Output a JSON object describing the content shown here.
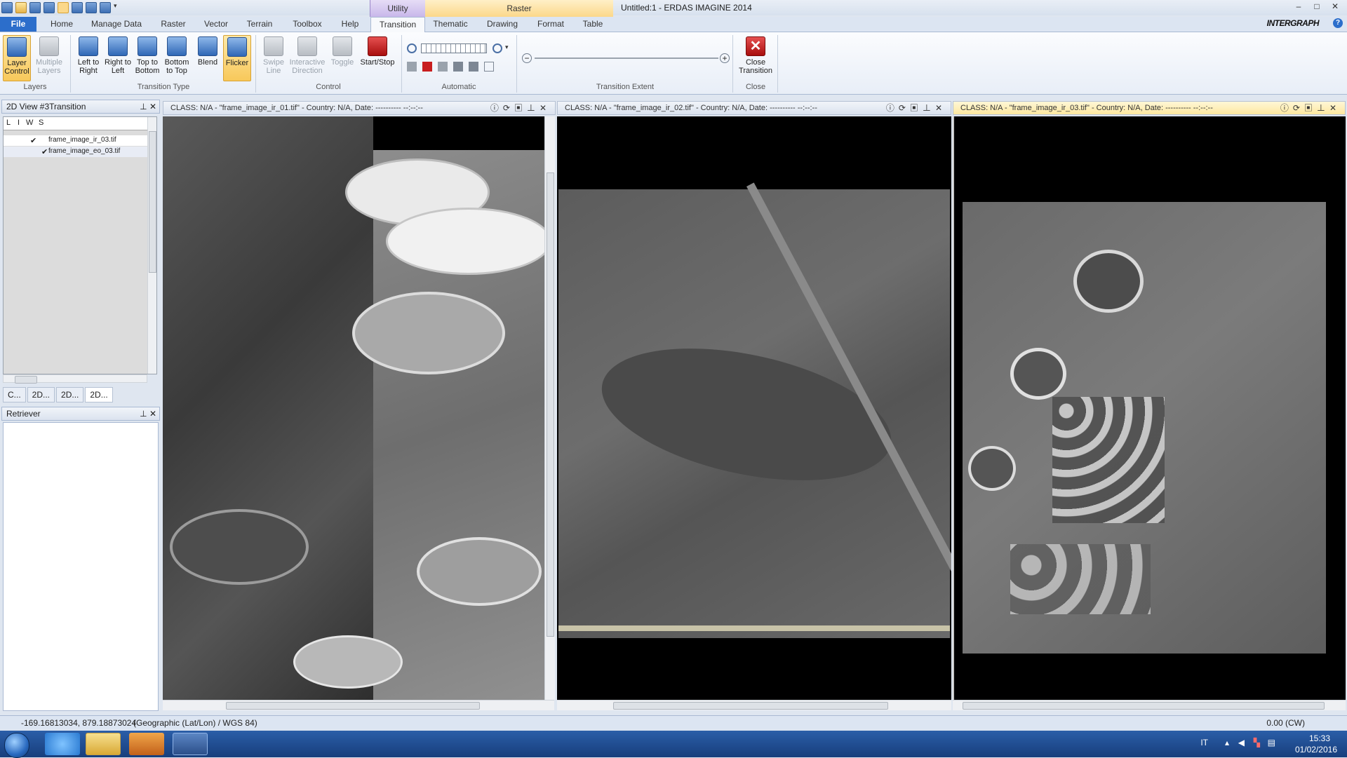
{
  "titlebar": {
    "context_utility": "Utility",
    "context_raster": "Raster",
    "title": "Untitled:1 - ERDAS IMAGINE 2014",
    "min_label": "–",
    "max_label": "□",
    "close_label": "✕"
  },
  "tabs": [
    "File",
    "Home",
    "Manage Data",
    "Raster",
    "Vector",
    "Terrain",
    "Toolbox",
    "Help",
    "Transition",
    "Thematic",
    "Drawing",
    "Format",
    "Table"
  ],
  "brand": "INTERGRAPH",
  "ribbon": {
    "layer_control": "Layer Control",
    "multiple_layers": "Multiple Layers",
    "group_layers": "Layers",
    "left_to_right": "Left to Right",
    "right_to_left": "Right to Left",
    "top_to_bottom": "Top to Bottom",
    "bottom_to_top": "Bottom to Top",
    "blend": "Blend",
    "flicker": "Flicker",
    "group_transition_type": "Transition Type",
    "swipe_line": "Swipe Line",
    "interactive_direction": "Interactive Direction",
    "toggle": "Toggle",
    "start_stop": "Start/Stop",
    "group_control": "Control",
    "group_automatic": "Automatic",
    "group_transition_extent": "Transition Extent",
    "close_transition": "Close Transition",
    "group_close": "Close"
  },
  "left_panel": {
    "title": "2D View #3Transition",
    "columns": [
      "L",
      "I",
      "W",
      "S"
    ],
    "layers": [
      {
        "name": "frame_image_ir_03.tif",
        "checked": true
      },
      {
        "name": "frame_image_eo_03.tif",
        "checked": true
      }
    ],
    "view_tabs": [
      "C...",
      "2D...",
      "2D...",
      "2D..."
    ],
    "retriever_title": "Retriever"
  },
  "viewers": [
    {
      "title": "CLASS: N/A - \"frame_image_ir_01.tif\" - Country: N/A, Date: ---------- --:--:--"
    },
    {
      "title": "CLASS: N/A - \"frame_image_ir_02.tif\" - Country: N/A, Date: ---------- --:--:--"
    },
    {
      "title": "CLASS: N/A - \"frame_image_ir_03.tif\" - Country: N/A, Date: ---------- --:--:--"
    }
  ],
  "statusbar": {
    "coords": "-169.16813034, 879.18873024",
    "projection": "(Geographic (Lat/Lon) / WGS 84)",
    "rotation": "0.00 (CW)"
  },
  "taskbar": {
    "language": "IT",
    "time": "15:33",
    "date": "01/02/2016"
  },
  "colors": {
    "accent": "#2c6ecb",
    "selected_button": "#f8c85a",
    "taskbar": "#1f4d92"
  }
}
